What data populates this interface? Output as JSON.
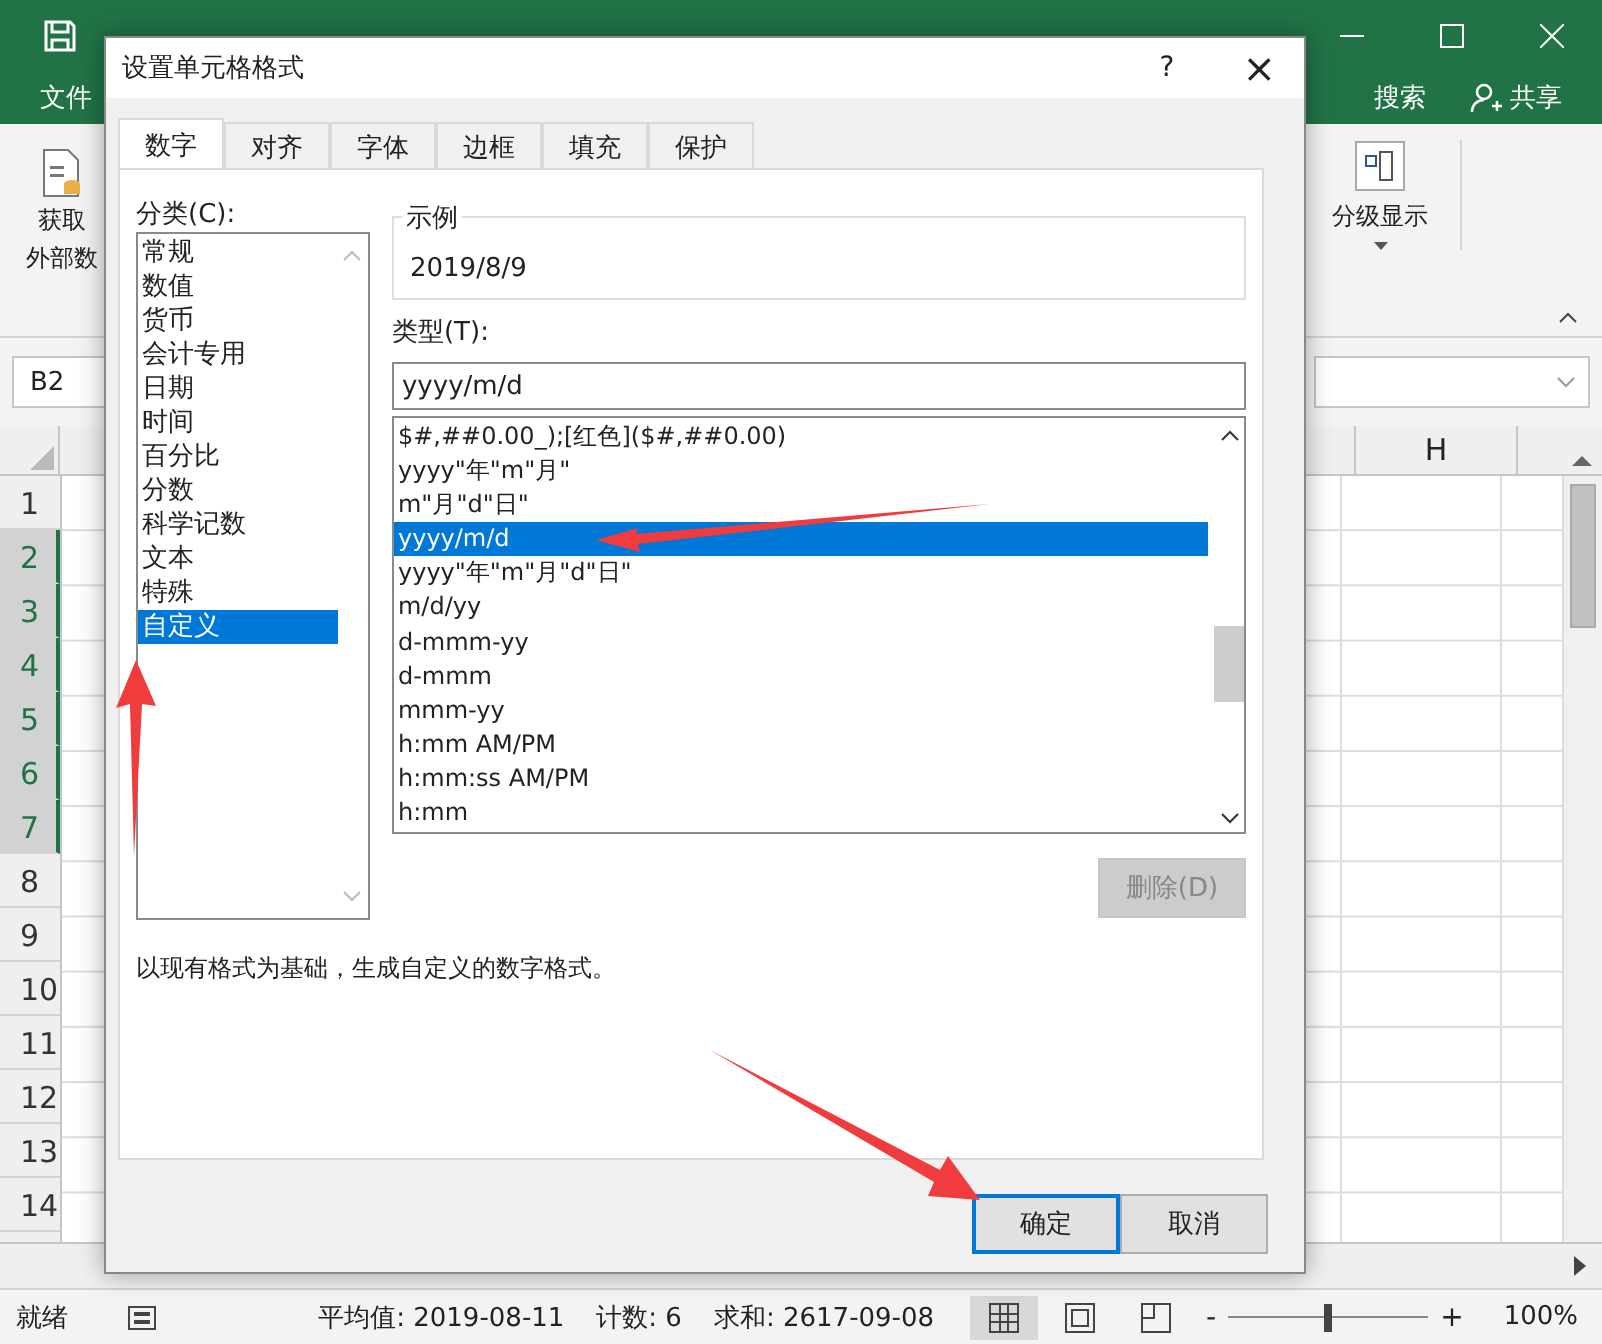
{
  "excel": {
    "ribbon_tabs": [
      {
        "label": "文件"
      }
    ],
    "tell_me": "搜索",
    "share": "共享",
    "ribbon_left": {
      "line1": "获取",
      "line2": "外部数"
    },
    "ribbon_right": {
      "label": "分级显示"
    },
    "name_box": "B2",
    "column_header": "H",
    "rows": [
      {
        "label": "1",
        "selected": false
      },
      {
        "label": "2",
        "selected": true
      },
      {
        "label": "3",
        "selected": true
      },
      {
        "label": "4",
        "selected": true
      },
      {
        "label": "5",
        "selected": true
      },
      {
        "label": "6",
        "selected": true
      },
      {
        "label": "7",
        "selected": true
      },
      {
        "label": "8",
        "selected": false
      },
      {
        "label": "9",
        "selected": false
      },
      {
        "label": "10",
        "selected": false
      },
      {
        "label": "11",
        "selected": false
      },
      {
        "label": "12",
        "selected": false
      },
      {
        "label": "13",
        "selected": false
      },
      {
        "label": "14",
        "selected": false
      }
    ],
    "status": "就绪",
    "stats": [
      "平均值: 2019-08-11",
      "计数: 6",
      "求和: 2617-09-08"
    ],
    "zoom": {
      "level": 0.5,
      "reading": "100%",
      "minus": "-",
      "plus": "+"
    }
  },
  "dialog": {
    "title": "设置单元格格式",
    "help": "?",
    "close": "×",
    "tabs": [
      {
        "label": "数字",
        "selected": true
      },
      {
        "label": "对齐",
        "selected": false
      },
      {
        "label": "字体",
        "selected": false
      },
      {
        "label": "边框",
        "selected": false
      },
      {
        "label": "填充",
        "selected": false
      },
      {
        "label": "保护",
        "selected": false
      }
    ],
    "category_label": "分类(C):",
    "categories": [
      {
        "label": "常规",
        "selected": false
      },
      {
        "label": "数值",
        "selected": false
      },
      {
        "label": "货币",
        "selected": false
      },
      {
        "label": "会计专用",
        "selected": false
      },
      {
        "label": "日期",
        "selected": false
      },
      {
        "label": "时间",
        "selected": false
      },
      {
        "label": "百分比",
        "selected": false
      },
      {
        "label": "分数",
        "selected": false
      },
      {
        "label": "科学记数",
        "selected": false
      },
      {
        "label": "文本",
        "selected": false
      },
      {
        "label": "特殊",
        "selected": false
      },
      {
        "label": "自定义",
        "selected": true
      }
    ],
    "sample_label": "示例",
    "sample": "2019/8/9",
    "type_label": "类型(T):",
    "type_value": "yyyy/m/d",
    "formats": [
      {
        "label": "$#,##0.00_);[红色]($#,##0.00)",
        "selected": false
      },
      {
        "label": "yyyy\"年\"m\"月\"",
        "selected": false
      },
      {
        "label": "m\"月\"d\"日\"",
        "selected": false
      },
      {
        "label": "yyyy/m/d",
        "selected": true
      },
      {
        "label": "yyyy\"年\"m\"月\"d\"日\"",
        "selected": false
      },
      {
        "label": "m/d/yy",
        "selected": false
      },
      {
        "label": "d-mmm-yy",
        "selected": false
      },
      {
        "label": "d-mmm",
        "selected": false
      },
      {
        "label": "mmm-yy",
        "selected": false
      },
      {
        "label": "h:mm AM/PM",
        "selected": false
      },
      {
        "label": "h:mm:ss AM/PM",
        "selected": false
      },
      {
        "label": "h:mm",
        "selected": false
      }
    ],
    "delete": {
      "label": "删除(D)",
      "disabled": true
    },
    "description": "以现有格式为基础，生成自定义的数字格式。",
    "buttons": [
      {
        "label": "确定",
        "default": true
      },
      {
        "label": "取消",
        "default": false
      }
    ]
  }
}
